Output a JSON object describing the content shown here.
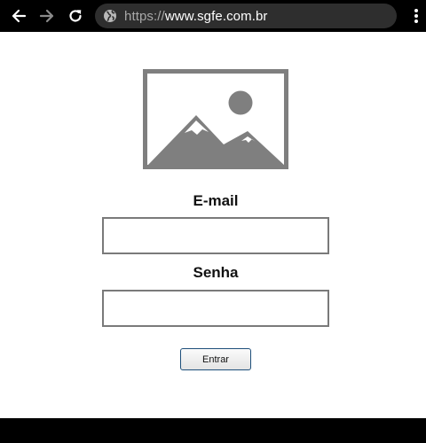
{
  "browser": {
    "url_scheme": "https://",
    "url_host": "www.sgfe.com.br",
    "icons": {
      "back": "arrow-left-icon",
      "forward": "arrow-right-icon",
      "reload": "reload-icon",
      "site_info": "globe-icon",
      "menu": "kebab-menu-icon"
    }
  },
  "login": {
    "logo_icon": "image-placeholder-icon",
    "email_label": "E-mail",
    "email_value": "",
    "password_label": "Senha",
    "password_value": "",
    "submit_label": "Entrar"
  },
  "colors": {
    "page_background": "#ffffff",
    "chrome_background": "#000000",
    "url_bar_background": "#2e2e2e",
    "placeholder_gray": "#7f7f7f",
    "field_border": "#7a7a7a",
    "button_border": "#1e4f7a"
  }
}
